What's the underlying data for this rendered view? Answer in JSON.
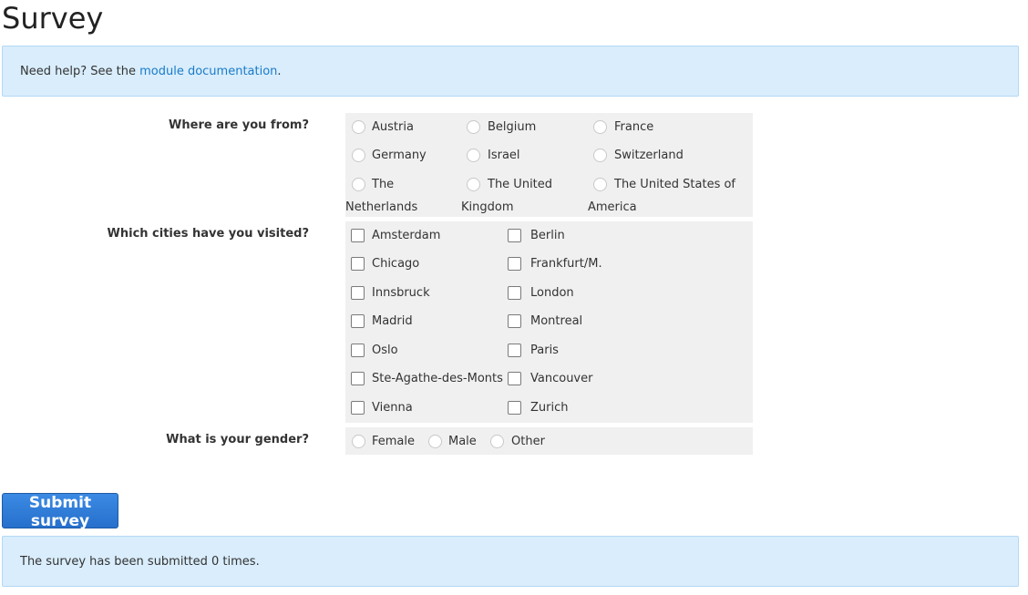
{
  "page": {
    "title": "Survey"
  },
  "help": {
    "prefix": "Need help? See the ",
    "link": "module documentation",
    "suffix": "."
  },
  "country": {
    "label": "Where are you from?",
    "options": [
      [
        "Austria"
      ],
      [
        "Belgium"
      ],
      [
        "France"
      ],
      [
        "Germany"
      ],
      [
        "Israel"
      ],
      [
        "Switzerland"
      ],
      [
        "The",
        "Netherlands"
      ],
      [
        "The United",
        "Kingdom"
      ],
      [
        "The United States of",
        "America"
      ]
    ]
  },
  "cities": {
    "label": "Which cities have you visited?",
    "options": [
      "Amsterdam",
      "Berlin",
      "Chicago",
      "Frankfurt/M.",
      "Innsbruck",
      "London",
      "Madrid",
      "Montreal",
      "Oslo",
      "Paris",
      "Ste-Agathe-des-Monts",
      "Vancouver",
      "Vienna",
      "Zurich"
    ]
  },
  "gender": {
    "label": "What is your gender?",
    "options": [
      "Female",
      "Male",
      "Other"
    ]
  },
  "submit": {
    "label": "Submit survey"
  },
  "status": {
    "text": "The survey has been submitted 0 times."
  }
}
